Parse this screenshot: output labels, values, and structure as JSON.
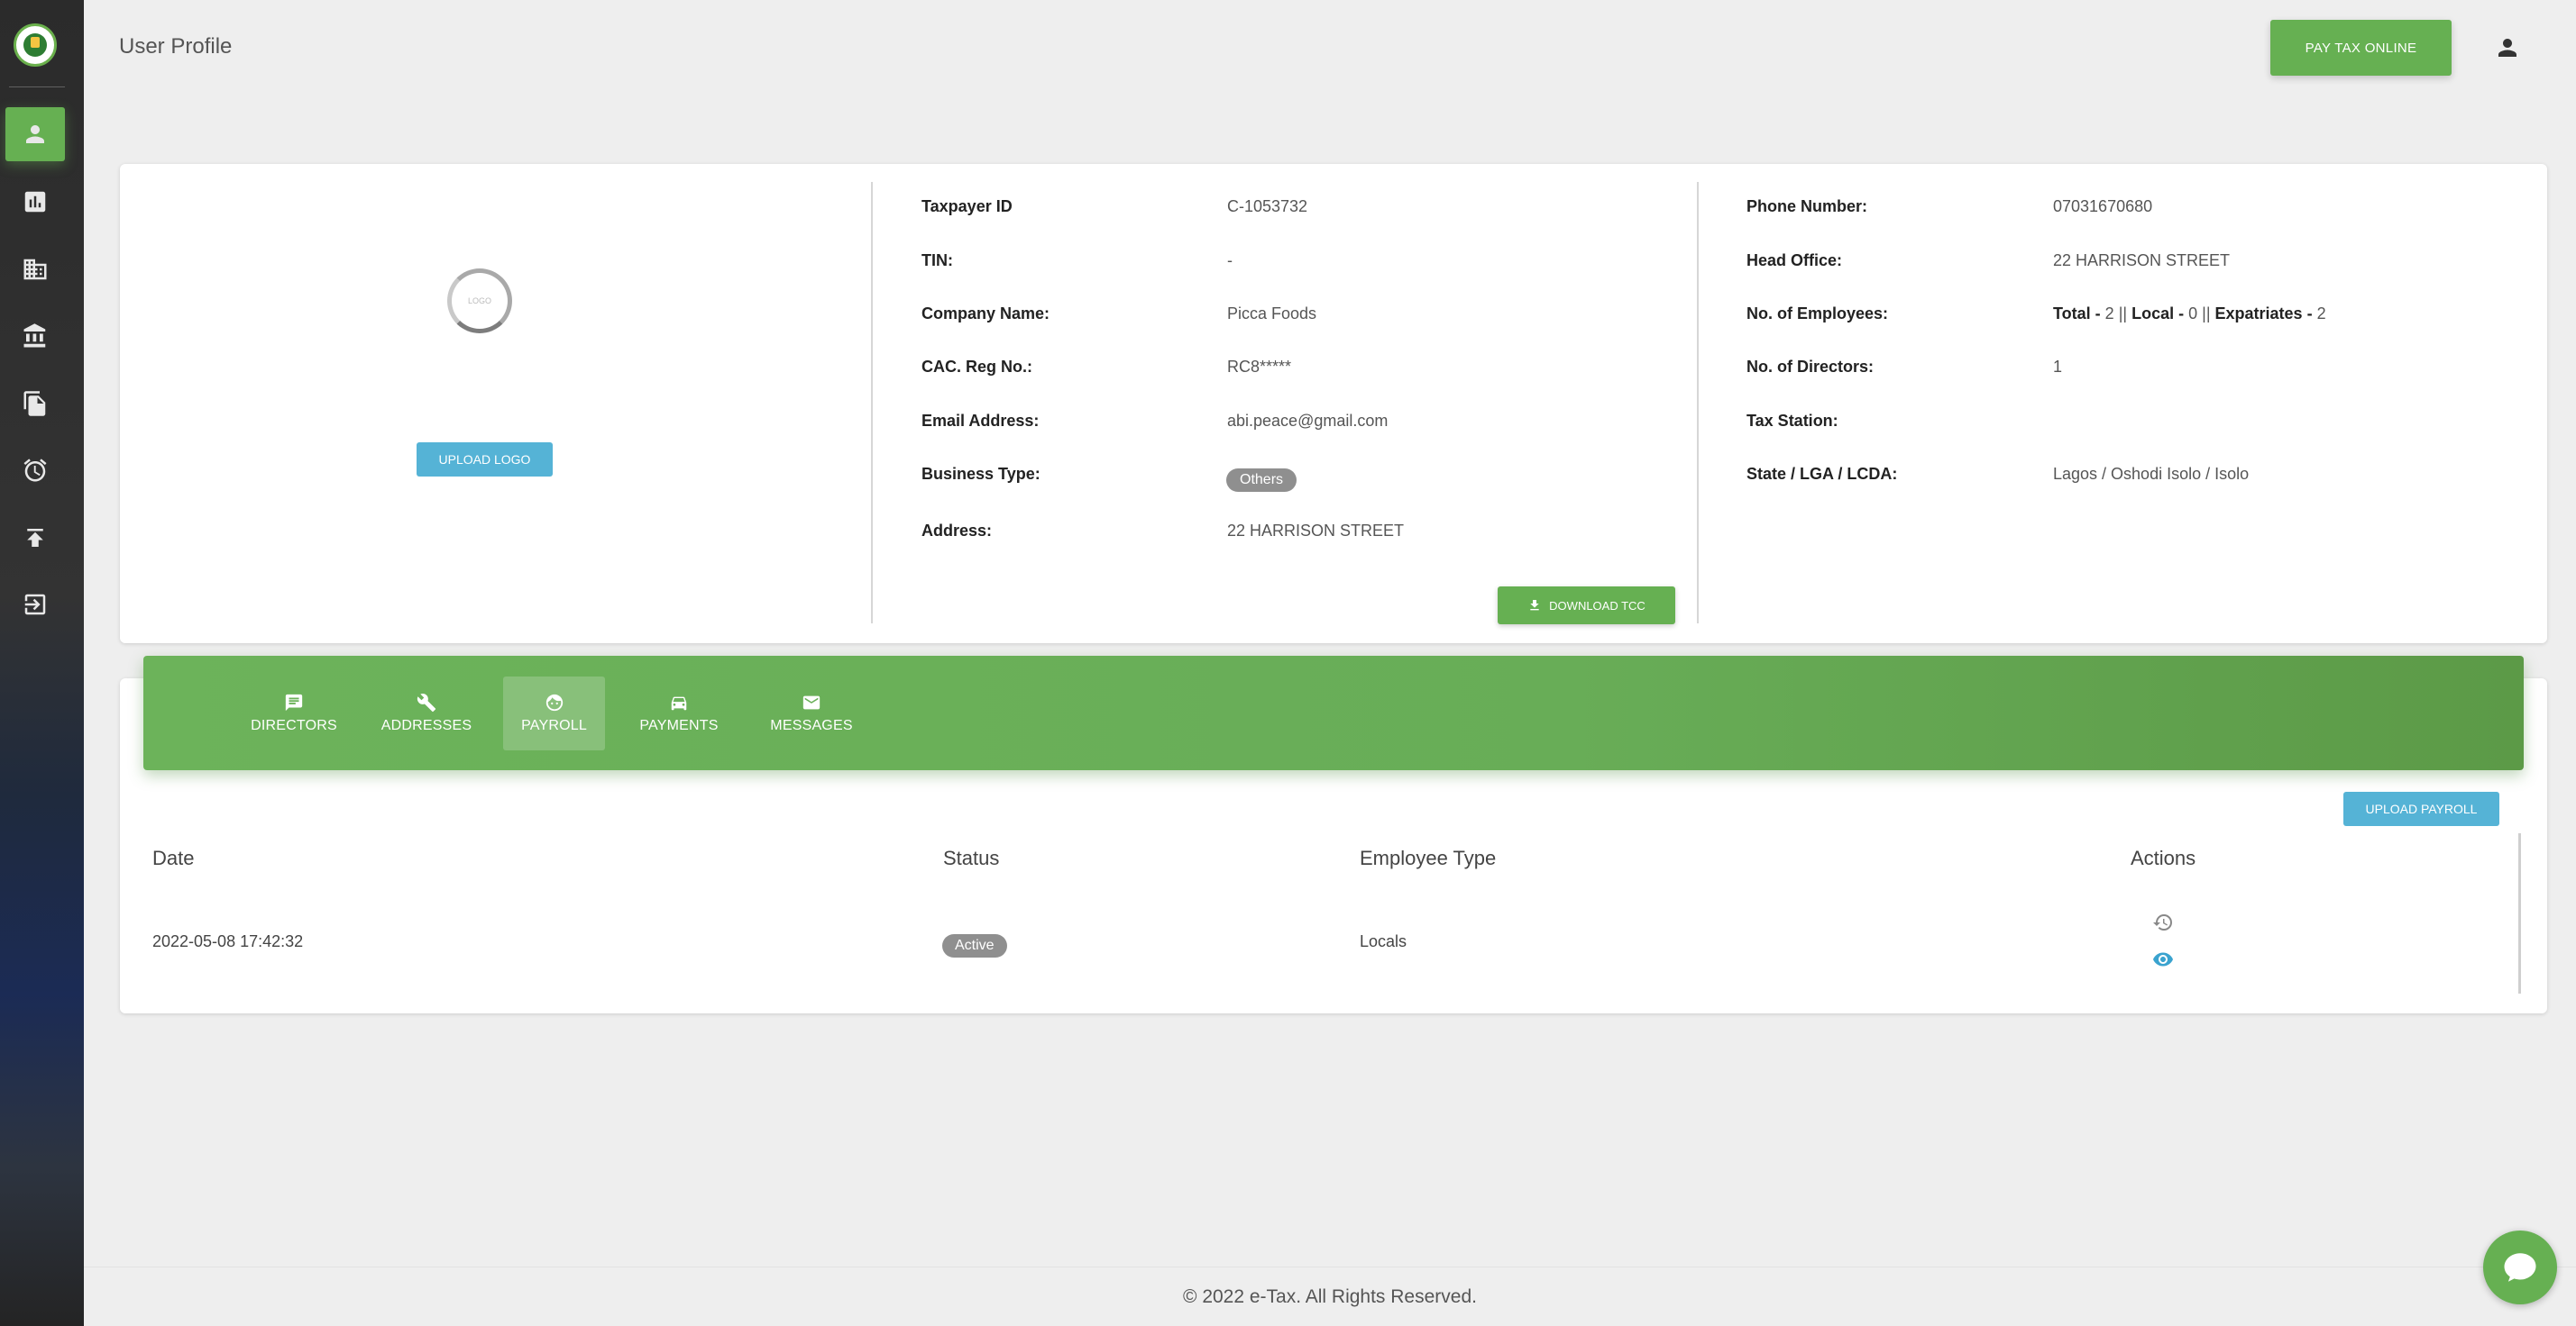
{
  "header": {
    "title": "User Profile",
    "pay_button": "PAY TAX ONLINE"
  },
  "sidebar": {
    "items": [
      {
        "icon": "person-icon",
        "active": true
      },
      {
        "icon": "bar-chart-icon"
      },
      {
        "icon": "building-icon"
      },
      {
        "icon": "bank-icon"
      },
      {
        "icon": "documents-icon"
      },
      {
        "icon": "alarm-clock-icon"
      },
      {
        "icon": "upload-icon"
      },
      {
        "icon": "logout-icon"
      }
    ]
  },
  "profile": {
    "logo_placeholder": "LOGO",
    "upload_logo": "UPLOAD LOGO",
    "left_fields": [
      {
        "label": "Taxpayer ID",
        "value": "C-1053732"
      },
      {
        "label": "TIN:",
        "value": "-"
      },
      {
        "label": "Company Name:",
        "value": "Picca Foods"
      },
      {
        "label": "CAC. Reg No.:",
        "value": "RC8*****"
      },
      {
        "label": "Email Address:",
        "value": "abi.peace@gmail.com"
      },
      {
        "label": "Business Type:",
        "value": "Others"
      },
      {
        "label": "Address:",
        "value": "22 HARRISON STREET"
      }
    ],
    "right_fields": [
      {
        "label": "Phone Number:",
        "value": "07031670680"
      },
      {
        "label": "Head Office:",
        "value": "22 HARRISON STREET"
      },
      {
        "label": "No. of Employees:",
        "value": ""
      },
      {
        "label": "No. of Directors:",
        "value": "1"
      },
      {
        "label": "Tax Station:",
        "value": ""
      },
      {
        "label": "State / LGA / LCDA:",
        "value": "Lagos / Oshodi Isolo / Isolo"
      }
    ],
    "employees": {
      "total_label": "Total -",
      "total": "2",
      "sep1": "||",
      "local_label": "Local -",
      "local": "0",
      "sep2": "||",
      "expat_label": "Expatriates -",
      "expat": "2"
    },
    "download_tcc": "DOWNLOAD TCC"
  },
  "tabs": [
    {
      "label": "DIRECTORS",
      "icon": "chat-bubble-icon"
    },
    {
      "label": "ADDRESSES",
      "icon": "wrench-icon"
    },
    {
      "label": "PAYROLL",
      "icon": "face-icon",
      "active": true
    },
    {
      "label": "PAYMENTS",
      "icon": "car-icon"
    },
    {
      "label": "MESSAGES",
      "icon": "mail-icon"
    }
  ],
  "payroll": {
    "upload_button": "UPLOAD PAYROLL",
    "columns": [
      "Date",
      "Status",
      "Employee Type",
      "Actions"
    ],
    "rows": [
      {
        "date": "2022-05-08 17:42:32",
        "status": "Active",
        "employee_type": "Locals"
      }
    ]
  },
  "footer": "© 2022 e-Tax. All Rights Reserved.",
  "colors": {
    "primary_green": "#66b052",
    "info_blue": "#55b3d6",
    "badge_grey": "#8f8f8f"
  }
}
